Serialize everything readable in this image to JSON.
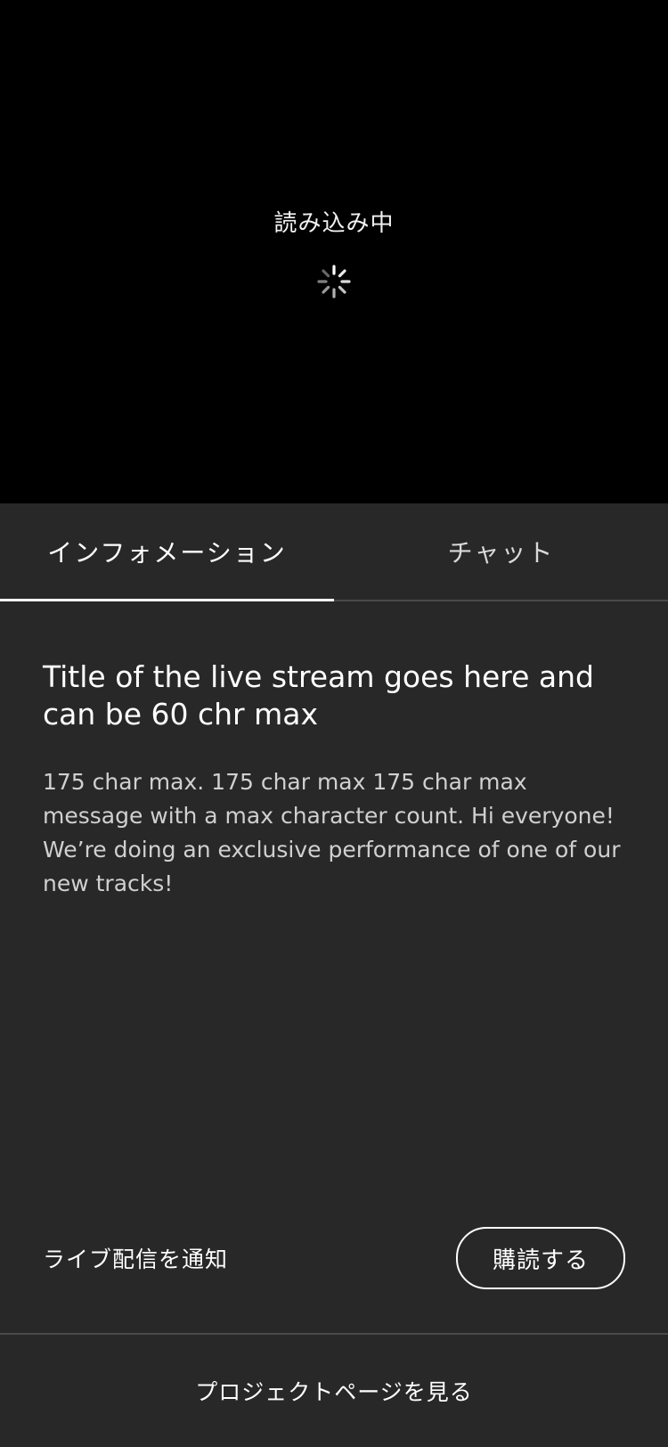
{
  "player": {
    "loading_text": "読み込み中"
  },
  "tabs": [
    {
      "label": "インフォメーション",
      "active": true
    },
    {
      "label": "チャット",
      "active": false
    }
  ],
  "stream": {
    "title": "Title of the live stream goes here and can be 60 chr max",
    "description": "175 char max. 175 char max 175 char max message with a max character count. Hi everyone! We’re doing an exclusive performance of one of our new tracks!"
  },
  "notify": {
    "label": "ライブ配信を通知",
    "button_label": "購読する"
  },
  "footer": {
    "link_label": "プロジェクトページを見る"
  },
  "colors": {
    "video_bg": "#000000",
    "panel_bg": "#282828",
    "text_primary": "#ffffff",
    "text_secondary": "#d0d0d0"
  }
}
